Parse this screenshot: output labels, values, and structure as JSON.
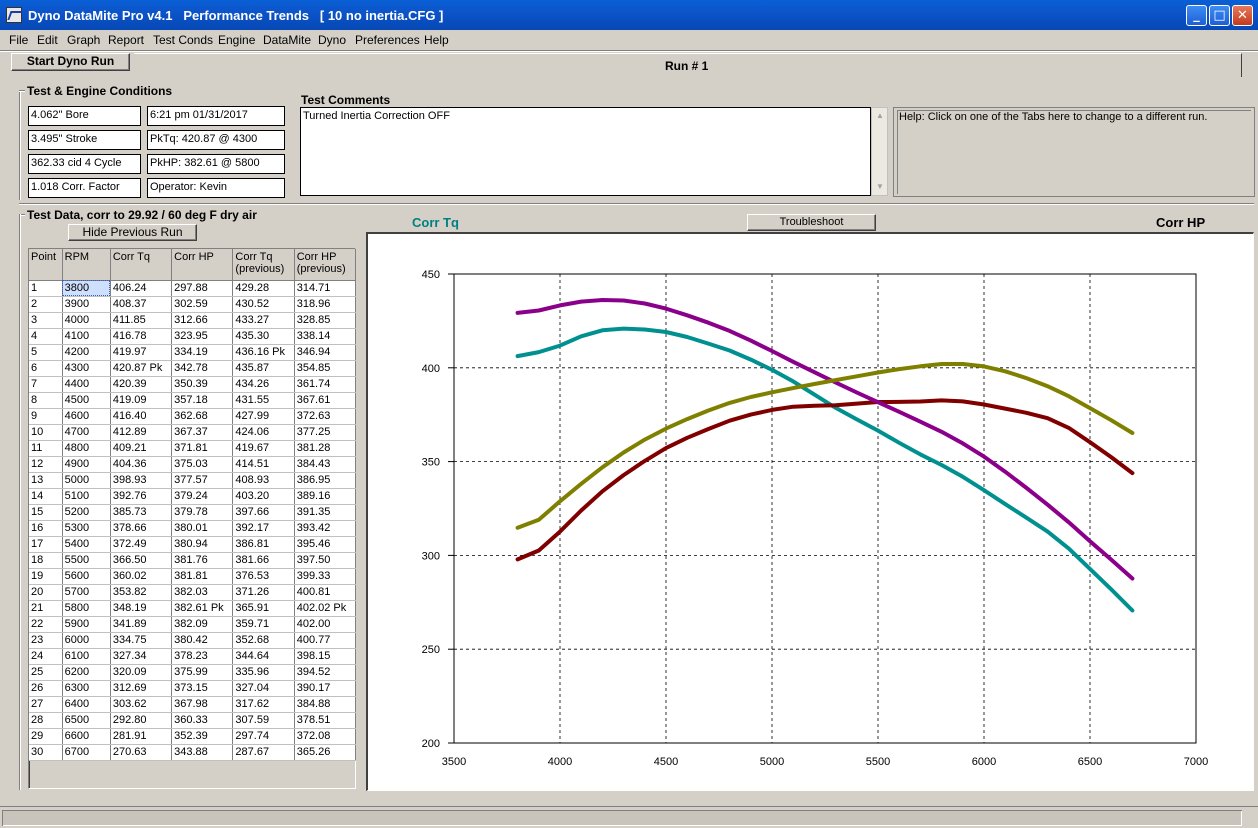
{
  "window": {
    "title": "Dyno DataMite Pro v4.1   Performance Trends   [ 10 no inertia.CFG ]",
    "minimize_glyph": "_",
    "maximize_glyph": "□",
    "close_glyph": "✕"
  },
  "menu": [
    "File",
    "Edit",
    "Graph",
    "Report",
    "Test Conds",
    "Engine",
    "DataMite",
    "Dyno",
    "Preferences",
    "Help"
  ],
  "toolbar": {
    "start_button": "Start Dyno Run",
    "run_tab": "Run # 1"
  },
  "conditions": {
    "title": "Test & Engine Conditions",
    "bore": "4.062\" Bore",
    "stroke": "3.495\" Stroke",
    "cid": "362.33 cid  4 Cycle",
    "corr_factor": "1.018 Corr. Factor",
    "datetime": "6:21 pm  01/31/2017",
    "pk_tq": "PkTq: 420.87 @  4300",
    "pk_hp": "PkHP: 382.61 @  5800",
    "operator": "Operator: Kevin"
  },
  "comments": {
    "title": "Test Comments",
    "text": "Turned Inertia Correction OFF"
  },
  "help": {
    "text": "Help:  Click on one of the Tabs here to change to a different run."
  },
  "test_data": {
    "title": "Test Data, corr to 29.92 / 60 deg F dry air",
    "hide_button": "Hide Previous Run",
    "columns": [
      "Point",
      "RPM",
      "Corr Tq",
      "Corr HP",
      "Corr Tq\n(previous)",
      "Corr HP\n(previous)"
    ],
    "rows": [
      [
        "1",
        "3800",
        "406.24",
        "297.88",
        "429.28",
        "314.71"
      ],
      [
        "2",
        "3900",
        "408.37",
        "302.59",
        "430.52",
        "318.96"
      ],
      [
        "3",
        "4000",
        "411.85",
        "312.66",
        "433.27",
        "328.85"
      ],
      [
        "4",
        "4100",
        "416.78",
        "323.95",
        "435.30",
        "338.14"
      ],
      [
        "5",
        "4200",
        "419.97",
        "334.19",
        "436.16 Pk",
        "346.94"
      ],
      [
        "6",
        "4300",
        "420.87 Pk",
        "342.78",
        "435.87",
        "354.85"
      ],
      [
        "7",
        "4400",
        "420.39",
        "350.39",
        "434.26",
        "361.74"
      ],
      [
        "8",
        "4500",
        "419.09",
        "357.18",
        "431.55",
        "367.61"
      ],
      [
        "9",
        "4600",
        "416.40",
        "362.68",
        "427.99",
        "372.63"
      ],
      [
        "10",
        "4700",
        "412.89",
        "367.37",
        "424.06",
        "377.25"
      ],
      [
        "11",
        "4800",
        "409.21",
        "371.81",
        "419.67",
        "381.28"
      ],
      [
        "12",
        "4900",
        "404.36",
        "375.03",
        "414.51",
        "384.43"
      ],
      [
        "13",
        "5000",
        "398.93",
        "377.57",
        "408.93",
        "386.95"
      ],
      [
        "14",
        "5100",
        "392.76",
        "379.24",
        "403.20",
        "389.16"
      ],
      [
        "15",
        "5200",
        "385.73",
        "379.78",
        "397.66",
        "391.35"
      ],
      [
        "16",
        "5300",
        "378.66",
        "380.01",
        "392.17",
        "393.42"
      ],
      [
        "17",
        "5400",
        "372.49",
        "380.94",
        "386.81",
        "395.46"
      ],
      [
        "18",
        "5500",
        "366.50",
        "381.76",
        "381.66",
        "397.50"
      ],
      [
        "19",
        "5600",
        "360.02",
        "381.81",
        "376.53",
        "399.33"
      ],
      [
        "20",
        "5700",
        "353.82",
        "382.03",
        "371.26",
        "400.81"
      ],
      [
        "21",
        "5800",
        "348.19",
        "382.61 Pk",
        "365.91",
        "402.02 Pk"
      ],
      [
        "22",
        "5900",
        "341.89",
        "382.09",
        "359.71",
        "402.00"
      ],
      [
        "23",
        "6000",
        "334.75",
        "380.42",
        "352.68",
        "400.77"
      ],
      [
        "24",
        "6100",
        "327.34",
        "378.23",
        "344.64",
        "398.15"
      ],
      [
        "25",
        "6200",
        "320.09",
        "375.99",
        "335.96",
        "394.52"
      ],
      [
        "26",
        "6300",
        "312.69",
        "373.15",
        "327.04",
        "390.17"
      ],
      [
        "27",
        "6400",
        "303.62",
        "367.98",
        "317.62",
        "384.88"
      ],
      [
        "28",
        "6500",
        "292.80",
        "360.33",
        "307.59",
        "378.51"
      ],
      [
        "29",
        "6600",
        "281.91",
        "352.39",
        "297.74",
        "372.08"
      ],
      [
        "30",
        "6700",
        "270.63",
        "343.88",
        "287.67",
        "365.26"
      ]
    ]
  },
  "graph": {
    "left_label": "Corr Tq",
    "right_label": "Corr HP",
    "troubleshoot_button": "Troubleshoot"
  },
  "colors": {
    "tq": "#009090",
    "hp": "#800000",
    "tq_prev": "#8b008b",
    "hp_prev": "#808000",
    "left_label": "#008080"
  },
  "chart_data": {
    "type": "line",
    "xlim": [
      3500,
      7000
    ],
    "ylim": [
      200,
      450
    ],
    "x_ticks": [
      3500,
      4000,
      4500,
      5000,
      5500,
      6000,
      6500,
      7000
    ],
    "y_ticks": [
      200,
      250,
      300,
      350,
      400,
      450
    ],
    "grid": true,
    "x": [
      3800,
      3900,
      4000,
      4100,
      4200,
      4300,
      4400,
      4500,
      4600,
      4700,
      4800,
      4900,
      5000,
      5100,
      5200,
      5300,
      5400,
      5500,
      5600,
      5700,
      5800,
      5900,
      6000,
      6100,
      6200,
      6300,
      6400,
      6500,
      6600,
      6700
    ],
    "series": [
      {
        "key": "tq",
        "values": [
          406.24,
          408.37,
          411.85,
          416.78,
          419.97,
          420.87,
          420.39,
          419.09,
          416.4,
          412.89,
          409.21,
          404.36,
          398.93,
          392.76,
          385.73,
          378.66,
          372.49,
          366.5,
          360.02,
          353.82,
          348.19,
          341.89,
          334.75,
          327.34,
          320.09,
          312.69,
          303.62,
          292.8,
          281.91,
          270.63
        ]
      },
      {
        "key": "hp",
        "values": [
          297.88,
          302.59,
          312.66,
          323.95,
          334.19,
          342.78,
          350.39,
          357.18,
          362.68,
          367.37,
          371.81,
          375.03,
          377.57,
          379.24,
          379.78,
          380.01,
          380.94,
          381.76,
          381.81,
          382.03,
          382.61,
          382.09,
          380.42,
          378.23,
          375.99,
          373.15,
          367.98,
          360.33,
          352.39,
          343.88
        ]
      },
      {
        "key": "tq_prev",
        "values": [
          429.28,
          430.52,
          433.27,
          435.3,
          436.16,
          435.87,
          434.26,
          431.55,
          427.99,
          424.06,
          419.67,
          414.51,
          408.93,
          403.2,
          397.66,
          392.17,
          386.81,
          381.66,
          376.53,
          371.26,
          365.91,
          359.71,
          352.68,
          344.64,
          335.96,
          327.04,
          317.62,
          307.59,
          297.74,
          287.67
        ]
      },
      {
        "key": "hp_prev",
        "values": [
          314.71,
          318.96,
          328.85,
          338.14,
          346.94,
          354.85,
          361.74,
          367.61,
          372.63,
          377.25,
          381.28,
          384.43,
          386.95,
          389.16,
          391.35,
          393.42,
          395.46,
          397.5,
          399.33,
          400.81,
          402.02,
          402.0,
          400.77,
          398.15,
          394.52,
          390.17,
          384.88,
          378.51,
          372.08,
          365.26
        ]
      }
    ]
  }
}
